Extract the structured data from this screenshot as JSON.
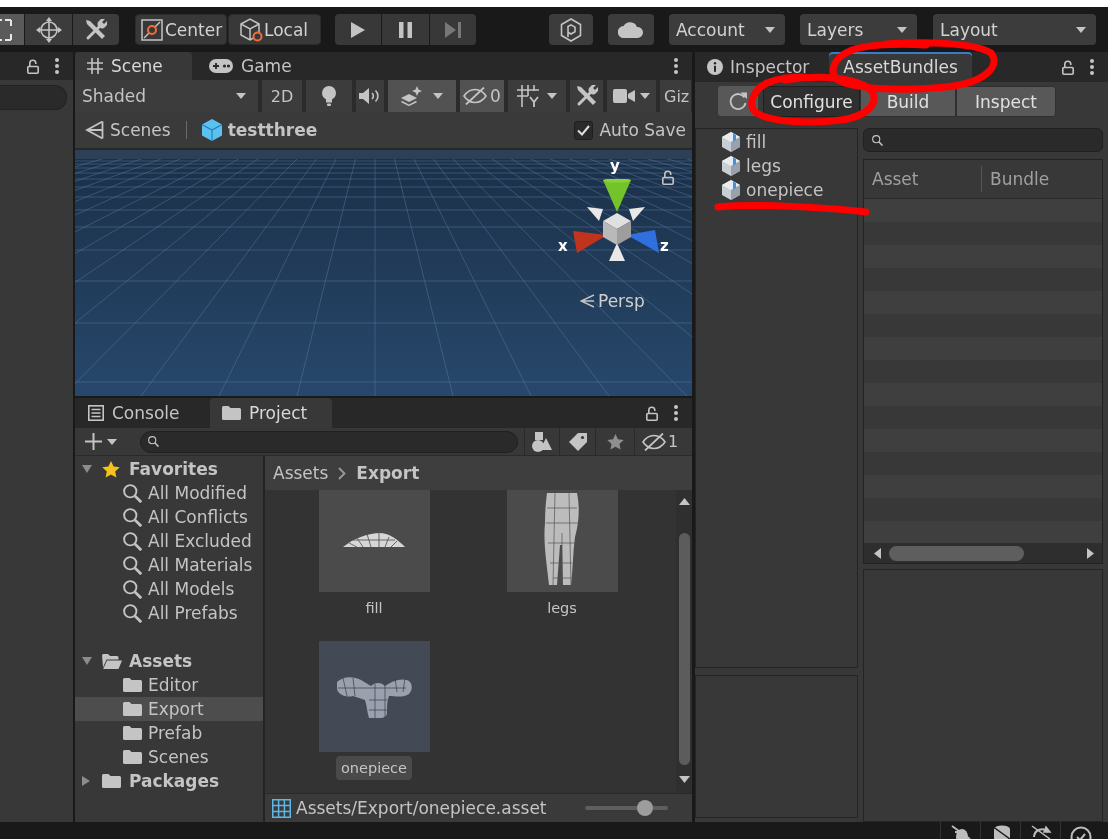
{
  "toolbar": {
    "tools": [
      {
        "selected": true
      },
      {
        "selected": false
      },
      {
        "selected": false
      }
    ],
    "pivot_buttons": [
      "Center",
      "Local"
    ],
    "dropdowns": [
      "Account",
      "Layers",
      "Layout"
    ]
  },
  "scene_panel": {
    "tabs": [
      {
        "label": "Scene",
        "selected": true
      },
      {
        "label": "Game",
        "selected": false
      }
    ],
    "toolbar": [
      {
        "kind": "dropdown",
        "label": "Shaded"
      },
      {
        "kind": "text_toggle",
        "label": "2D",
        "on": false
      },
      {
        "kind": "lighting",
        "on": false
      },
      {
        "kind": "audio",
        "on": false
      },
      {
        "kind": "effects",
        "on": true
      },
      {
        "kind": "visibility",
        "label": "0",
        "on": true
      },
      {
        "kind": "grid",
        "on": false
      },
      {
        "kind": "tools",
        "on": false
      },
      {
        "kind": "camera",
        "on": false
      },
      {
        "kind": "gizmos",
        "label": "Giz"
      }
    ],
    "breadcrumb": [
      "Scenes",
      "testthree"
    ],
    "auto_save": {
      "label": "Auto Save",
      "checked": true
    },
    "axis_labels": [
      "y",
      "x",
      "z"
    ],
    "projection": "Persp"
  },
  "project_panel": {
    "tabs": [
      {
        "label": "Console",
        "selected": false
      },
      {
        "label": "Project",
        "selected": true
      }
    ],
    "hidden_count": "1",
    "tree": [
      {
        "kind": "favorites",
        "label": "Favorites",
        "expanded": true,
        "selected": false,
        "children": [
          {
            "label": "All Modified",
            "selected": false
          },
          {
            "label": "All Conflicts",
            "selected": false
          },
          {
            "label": "All Excluded",
            "selected": false
          },
          {
            "label": "All Materials",
            "selected": false
          },
          {
            "label": "All Models",
            "selected": false
          },
          {
            "label": "All Prefabs",
            "selected": false
          }
        ]
      },
      {
        "kind": "folder",
        "label": "Assets",
        "expanded": true,
        "selected": false,
        "children": [
          {
            "label": "Editor",
            "selected": false
          },
          {
            "label": "Export",
            "selected": true
          },
          {
            "label": "Prefab",
            "selected": false
          },
          {
            "label": "Scenes",
            "selected": false
          }
        ]
      },
      {
        "kind": "folder",
        "label": "Packages",
        "expanded": false,
        "selected": false
      }
    ],
    "path": [
      "Assets",
      "Export"
    ],
    "assets": [
      {
        "name": "fill",
        "selected": false
      },
      {
        "name": "legs",
        "selected": false
      },
      {
        "name": "onepiece",
        "selected": true
      }
    ],
    "selected_path": "Assets/Export/onepiece.asset",
    "zoom_slider": {
      "level": 0.72
    }
  },
  "bundles_panel": {
    "tabs": [
      {
        "label": "Inspector",
        "selected": false
      },
      {
        "label": "AssetBundles",
        "selected": true
      }
    ],
    "modes": [
      {
        "label": "Configure",
        "selected": true
      },
      {
        "label": "Build",
        "selected": false
      },
      {
        "label": "Inspect",
        "selected": false
      }
    ],
    "bundles": [
      {
        "name": "fill",
        "selected": false
      },
      {
        "name": "legs",
        "selected": false
      },
      {
        "name": "onepiece",
        "selected": false
      }
    ],
    "columns": [
      "Asset",
      "Bundle"
    ]
  }
}
